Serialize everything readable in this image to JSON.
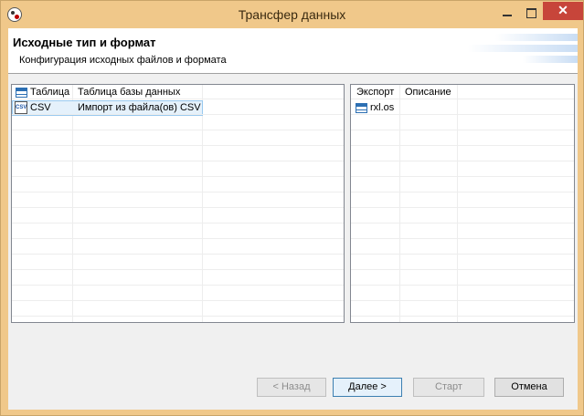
{
  "window": {
    "title": "Трансфер данных"
  },
  "header": {
    "title": "Исходные тип и формат",
    "subtitle": "Конфигурация исходных файлов и формата"
  },
  "source_table": {
    "columns": [
      "Таблица",
      "Таблица базы данных"
    ],
    "rows": [
      {
        "name": "CSV",
        "description": "Импорт из файла(ов) CSV",
        "icon": "csv-file-icon",
        "selected": true
      }
    ]
  },
  "target_table": {
    "columns": [
      "Экспорт",
      "Описание"
    ],
    "rows": [
      {
        "name": "rxl.os",
        "icon": "table-icon"
      }
    ]
  },
  "buttons": {
    "back": "< Назад",
    "next": "Далее >",
    "start": "Старт",
    "cancel": "Отмена"
  },
  "colors": {
    "title_bar": "#f0c88a",
    "close_button": "#c7453a",
    "selection": "#e5f1fb"
  }
}
